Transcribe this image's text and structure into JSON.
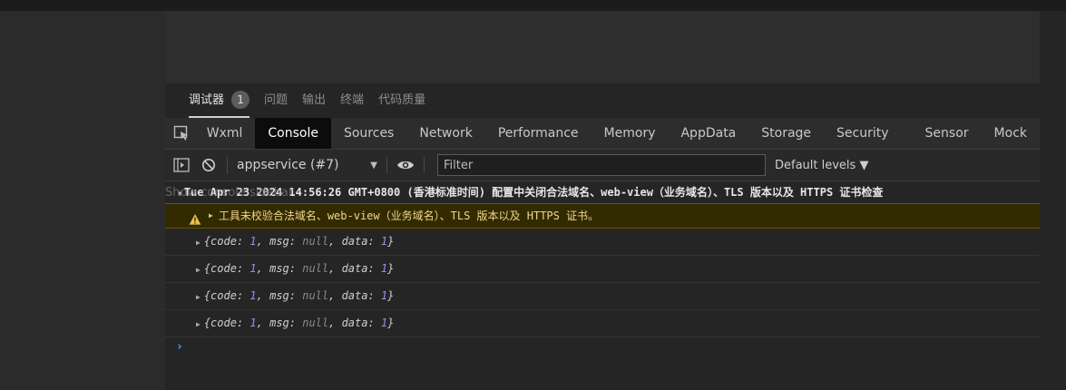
{
  "panel_tabs": {
    "debugger": "调试器",
    "badge": "1",
    "items": [
      "问题",
      "输出",
      "终端",
      "代码质量"
    ]
  },
  "devtools_tabs": [
    "Wxml",
    "Console",
    "Sources",
    "Network",
    "Performance",
    "Memory",
    "AppData",
    "Storage",
    "Security",
    "Sensor",
    "Mock"
  ],
  "toolbar": {
    "context": "appservice (#7)",
    "filter_placeholder": "Filter",
    "levels": "Default levels ▼"
  },
  "console": {
    "group_header": "Tue Apr 23 2024 14:56:26 GMT+0800 (香港标准时间) 配置中关闭合法域名、web-view（业务域名）、TLS 版本以及 HTTPS 证书检查",
    "sidebar_overlay": "Show console sidebar",
    "warning": "工具未校验合法域名、web-view（业务域名）、TLS 版本以及 HTTPS 证书。",
    "logs": [
      {
        "code": "1",
        "msg": "null",
        "data": "1"
      },
      {
        "code": "1",
        "msg": "null",
        "data": "1"
      },
      {
        "code": "1",
        "msg": "null",
        "data": "1"
      },
      {
        "code": "1",
        "msg": "null",
        "data": "1"
      }
    ],
    "prompt": "›"
  },
  "colors": {
    "accent_warning": "#f0c24a",
    "number": "#9f8cf0",
    "prompt": "#4aa3ff"
  }
}
